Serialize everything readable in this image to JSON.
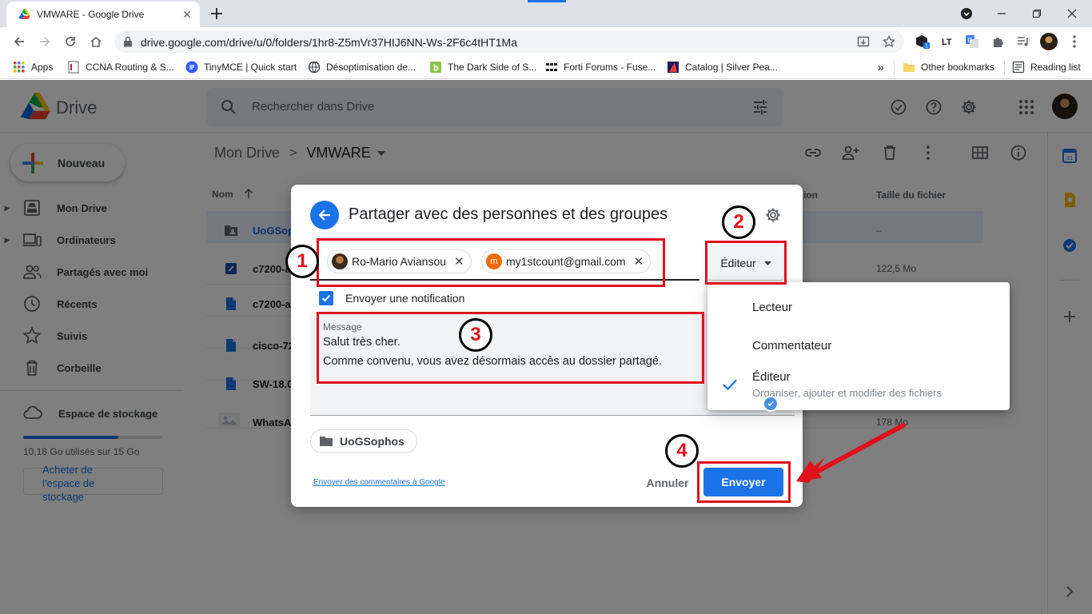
{
  "browser": {
    "tab_title": "VMWARE - Google Drive",
    "url": "drive.google.com/drive/u/0/folders/1hr8-Z5mVr37HIJ6NN-Ws-2F6c4tHT1Ma",
    "bookmarks": [
      {
        "label": "Apps"
      },
      {
        "label": "CCNA Routing & S..."
      },
      {
        "label": "TinyMCE | Quick start"
      },
      {
        "label": "Désoptimisation de..."
      },
      {
        "label": "The Dark Side of S..."
      },
      {
        "label": "Forti Forums - Fuse..."
      },
      {
        "label": "Catalog | Silver Pea..."
      }
    ],
    "more_bookmarks": "»",
    "other_bookmarks": "Other bookmarks",
    "reading_list": "Reading list"
  },
  "drive": {
    "app_name": "Drive",
    "search_placeholder": "Rechercher dans Drive",
    "new_button": "Nouveau",
    "sidebar": [
      {
        "label": "Mon Drive"
      },
      {
        "label": "Ordinateurs"
      },
      {
        "label": "Partagés avec moi"
      },
      {
        "label": "Récents"
      },
      {
        "label": "Suivis"
      },
      {
        "label": "Corbeille"
      }
    ],
    "storage": {
      "label": "Espace de stockage",
      "usage_text": "10,18 Go utilisés sur 15 Go",
      "used_fraction": 0.679,
      "buy_label": "Acheter de l'espace de stockage"
    },
    "breadcrumb": {
      "root": "Mon Drive",
      "separator": ">",
      "current": "VMWARE"
    },
    "columns": {
      "name": "Nom",
      "modified": "ion",
      "size": "Taille du fichier"
    },
    "files": [
      {
        "name": "UoGSop",
        "size": "–"
      },
      {
        "name": "c7200-a",
        "size": "122,5 Mo"
      },
      {
        "name": "c7200-a",
        "size": ""
      },
      {
        "name": "cisco-72",
        "size": ""
      },
      {
        "name": "SW-18.0",
        "size": ""
      },
      {
        "name": "WhatsAp",
        "size": "178 Mo"
      }
    ]
  },
  "share_dialog": {
    "title": "Partager avec des personnes et des groupes",
    "recipients": [
      {
        "name": "Ro-Mario Aviansou",
        "initial": ""
      },
      {
        "name": "my1stcount@gmail.com",
        "initial": "m"
      }
    ],
    "role_button": "Éditeur",
    "notify_label": "Envoyer une notification",
    "notify_checked": true,
    "message_label": "Message",
    "message_lines": [
      "Salut très cher.",
      "Comme convenu, vous avez désormais accès au dossier partagé."
    ],
    "folder_chip": "UoGSophos",
    "feedback_link": "Envoyer des commentaires à Google",
    "cancel_button": "Annuler",
    "send_button": "Envoyer"
  },
  "role_menu": {
    "options": [
      {
        "label": "Lecteur"
      },
      {
        "label": "Commentateur"
      },
      {
        "label": "Éditeur",
        "description": "Organiser, ajouter et modifier des fichiers",
        "selected": true
      }
    ]
  },
  "annotations": {
    "steps": [
      "1",
      "2",
      "3",
      "4"
    ],
    "color": "#e0101c"
  },
  "colors": {
    "accent": "#1a73e8",
    "annotation_red": "#e0101c"
  }
}
